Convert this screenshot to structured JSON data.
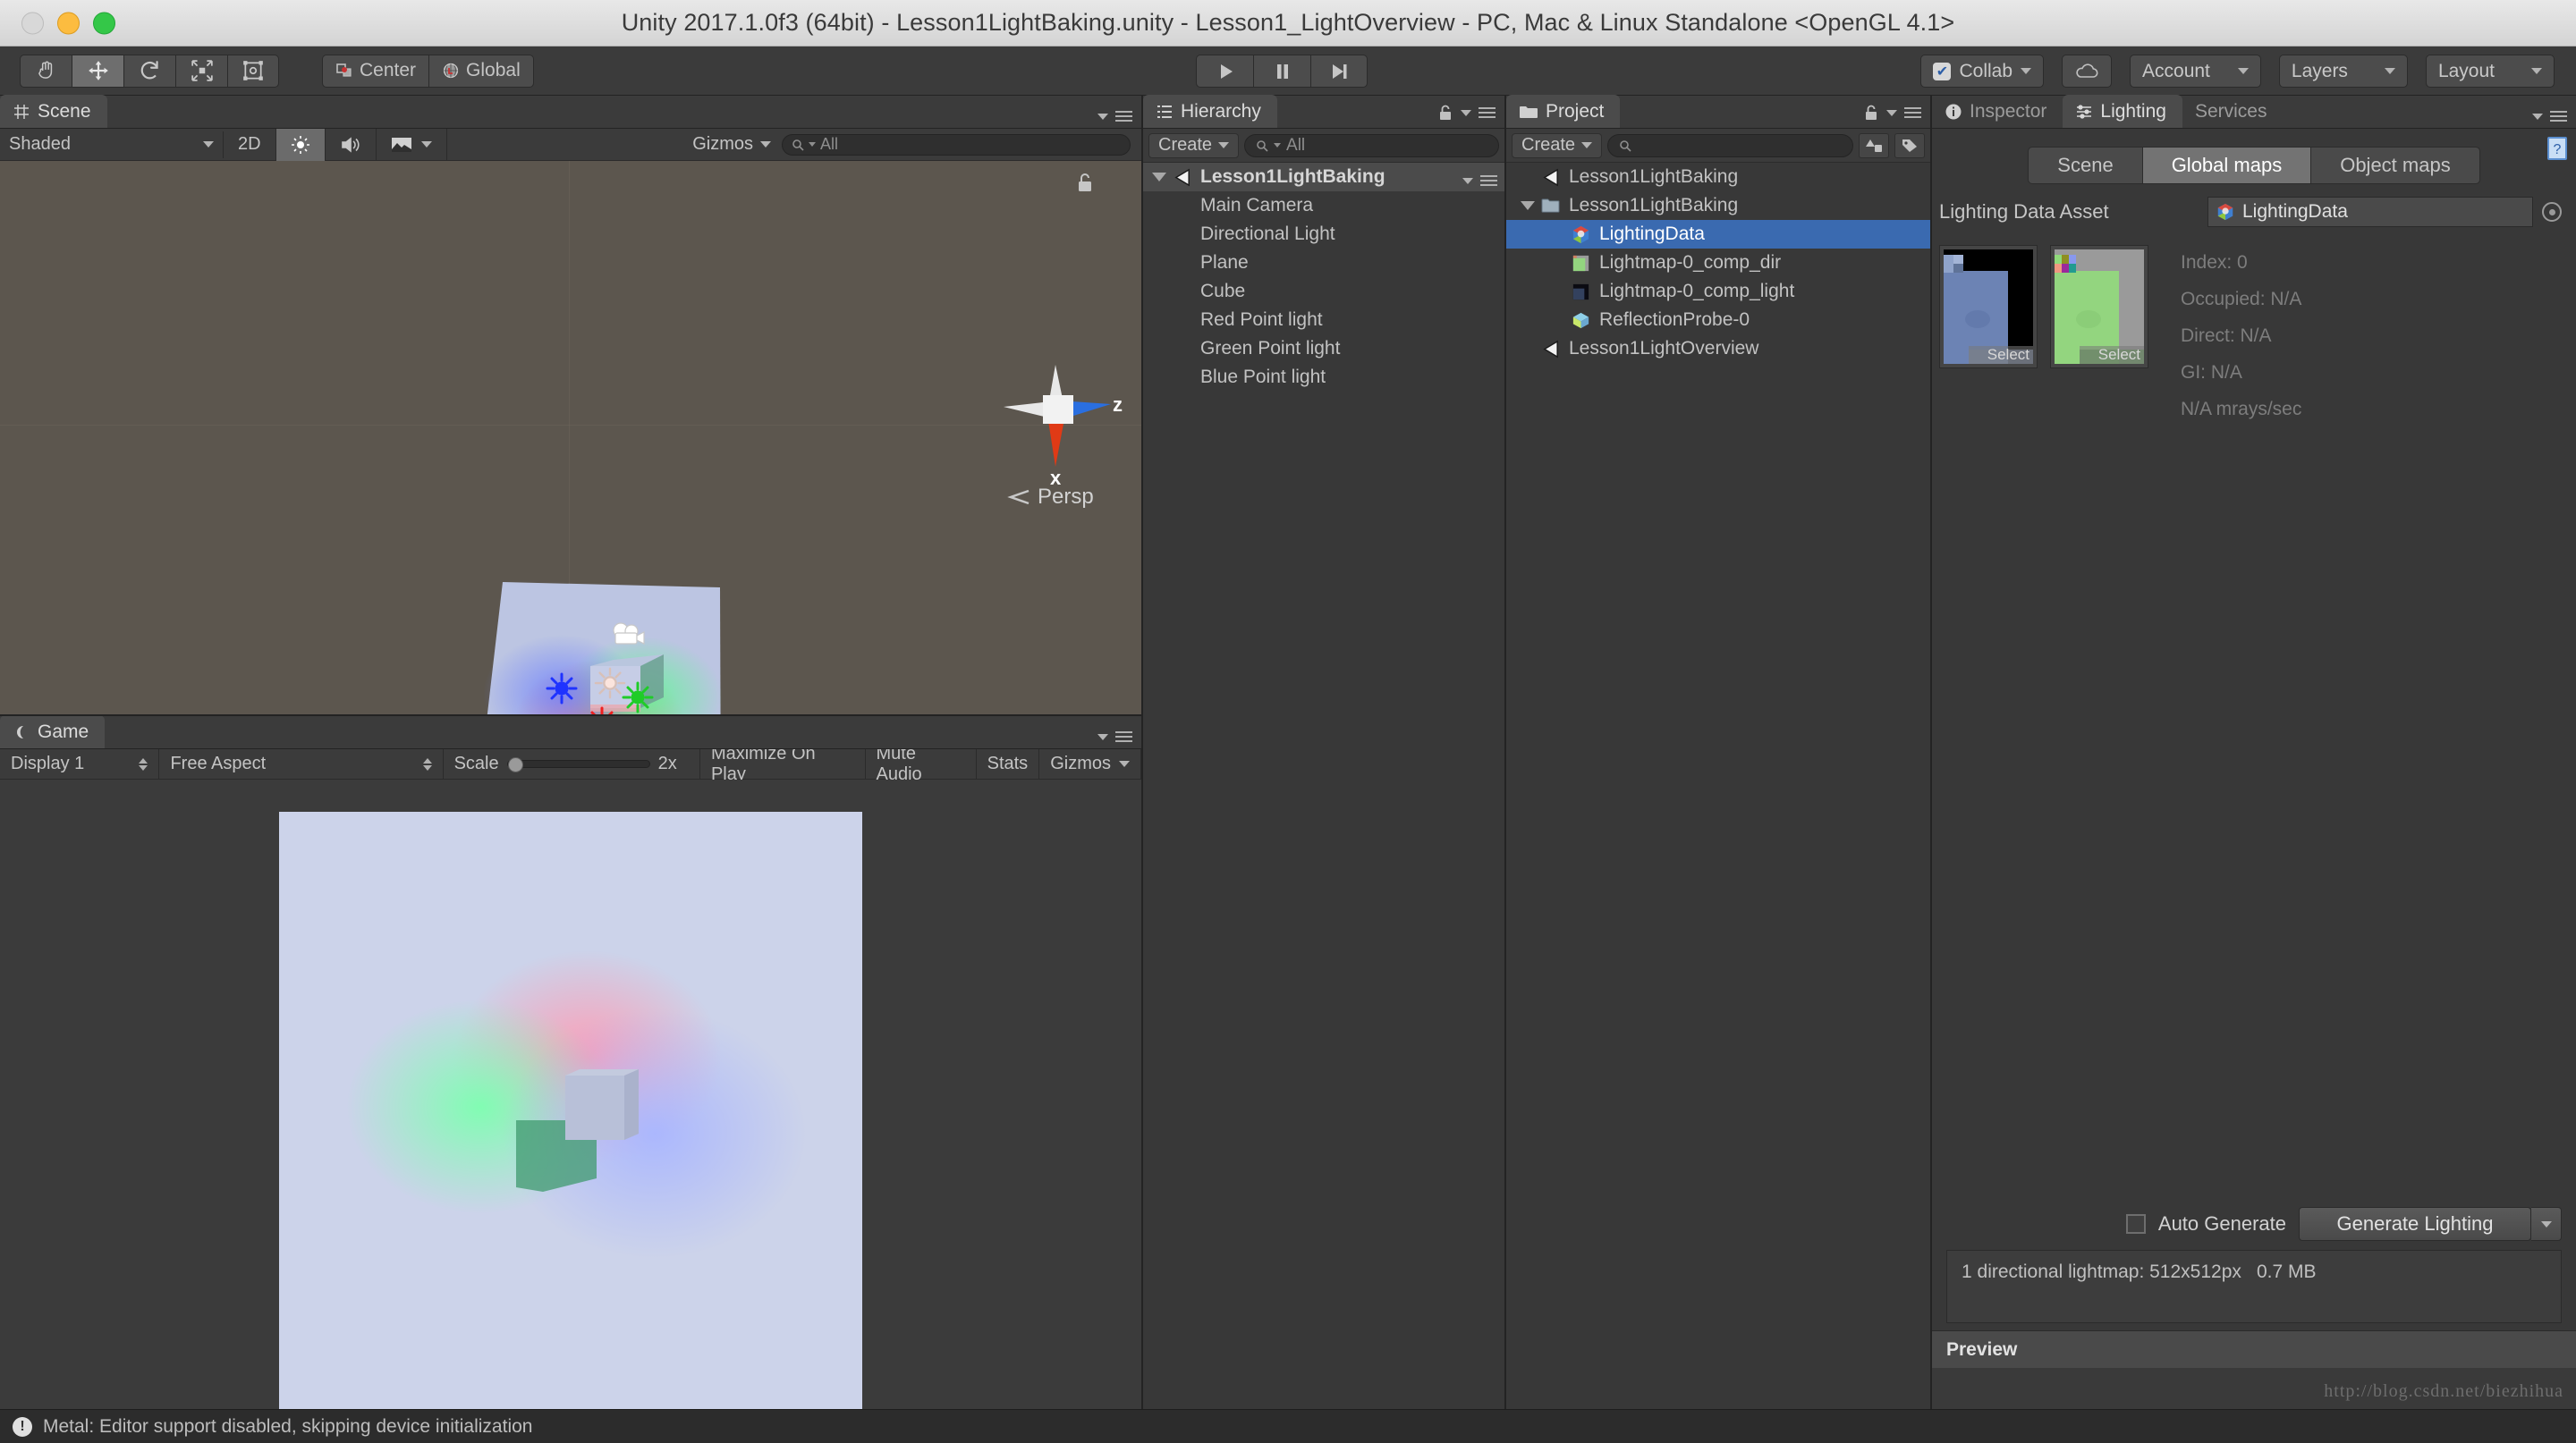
{
  "window": {
    "title": "Unity 2017.1.0f3 (64bit) - Lesson1LightBaking.unity - Lesson1_LightOverview - PC, Mac & Linux Standalone <OpenGL 4.1>"
  },
  "toolbar": {
    "tools": [
      {
        "name": "hand-tool",
        "glyph": "✋",
        "active": false
      },
      {
        "name": "move-tool",
        "glyph": "✥",
        "active": true
      },
      {
        "name": "rotate-tool",
        "glyph": "↻",
        "active": false
      },
      {
        "name": "scale-tool",
        "glyph": "⤡",
        "active": false
      },
      {
        "name": "rect-tool",
        "glyph": "▣",
        "active": false
      }
    ],
    "pivot_label": "Center",
    "space_label": "Global",
    "play_label": "Play",
    "pause_label": "Pause",
    "step_label": "Step",
    "collab_label": "Collab",
    "cloud_label": "Cloud",
    "account_label": "Account",
    "layers_label": "Layers",
    "layout_label": "Layout"
  },
  "scene": {
    "tab_label": "Scene",
    "draw_mode": "Shaded",
    "toggle_2d": "2D",
    "lighting_toggle": "Lighting",
    "audio_toggle": "Audio",
    "effects_toggle": "Effects",
    "gizmos_label": "Gizmos",
    "gizmos_search_placeholder": "All",
    "gizmo_axis_x": "x",
    "gizmo_axis_z": "z",
    "projection_label": "Persp"
  },
  "game": {
    "tab_label": "Game",
    "display": "Display 1",
    "aspect": "Free Aspect",
    "scale_label": "Scale",
    "scale_value": "2x",
    "maximize_label": "Maximize On Play",
    "mute_label": "Mute Audio",
    "stats_label": "Stats",
    "gizmos_label": "Gizmos"
  },
  "hierarchy": {
    "tab_label": "Hierarchy",
    "create_label": "Create",
    "search_placeholder": "All",
    "root": "Lesson1LightBaking",
    "items": [
      {
        "label": "Main Camera"
      },
      {
        "label": "Directional Light"
      },
      {
        "label": "Plane"
      },
      {
        "label": "Cube"
      },
      {
        "label": "Red Point light"
      },
      {
        "label": "Green Point light"
      },
      {
        "label": "Blue Point light"
      }
    ]
  },
  "project": {
    "tab_label": "Project",
    "create_label": "Create",
    "search_placeholder": "",
    "items": [
      {
        "label": "Lesson1LightBaking",
        "icon": "unity-scene-icon",
        "indent": 0,
        "selected": false,
        "expandable": false
      },
      {
        "label": "Lesson1LightBaking",
        "icon": "folder-icon",
        "indent": 0,
        "selected": false,
        "expandable": true
      },
      {
        "label": "LightingData",
        "icon": "lighting-data-icon",
        "indent": 1,
        "selected": true,
        "expandable": false
      },
      {
        "label": "Lightmap-0_comp_dir",
        "icon": "lightmap-dir-icon",
        "indent": 1,
        "selected": false,
        "expandable": false
      },
      {
        "label": "Lightmap-0_comp_light",
        "icon": "lightmap-light-icon",
        "indent": 1,
        "selected": false,
        "expandable": false
      },
      {
        "label": "ReflectionProbe-0",
        "icon": "reflection-probe-icon",
        "indent": 1,
        "selected": false,
        "expandable": false
      },
      {
        "label": "Lesson1LightOverview",
        "icon": "unity-scene-icon",
        "indent": 0,
        "selected": false,
        "expandable": false
      }
    ]
  },
  "right_panel": {
    "tabs": [
      {
        "label": "Inspector",
        "active": false
      },
      {
        "label": "Lighting",
        "active": true
      },
      {
        "label": "Services",
        "active": false
      }
    ],
    "lighting": {
      "subtabs": [
        {
          "label": "Scene",
          "active": false
        },
        {
          "label": "Global maps",
          "active": true
        },
        {
          "label": "Object maps",
          "active": false
        }
      ],
      "asset_field_label": "Lighting Data Asset",
      "asset_value": "LightingData",
      "map_select_label": "Select",
      "stats": [
        "Index: 0",
        "Occupied: N/A",
        "Direct: N/A",
        "GI: N/A",
        "N/A mrays/sec"
      ],
      "auto_generate_label": "Auto Generate",
      "generate_button": "Generate Lighting",
      "lightmap_summary": "1 directional lightmap: 512x512px",
      "lightmap_size": "0.7 MB",
      "preview_label": "Preview"
    }
  },
  "status": {
    "message": "Metal: Editor support disabled, skipping device initialization"
  },
  "watermark": "http://blog.csdn.net/biezhihua",
  "colors": {
    "selection_blue": "#3a6ab0",
    "panel_bg": "#383838",
    "toolbar_bg": "#3b3b3b",
    "scene_bg": "#5c564e",
    "plane_color": "#bcc5e2",
    "light_red": "#ff2b2b",
    "light_green": "#2ecc2e",
    "light_blue": "#2b44ff"
  }
}
